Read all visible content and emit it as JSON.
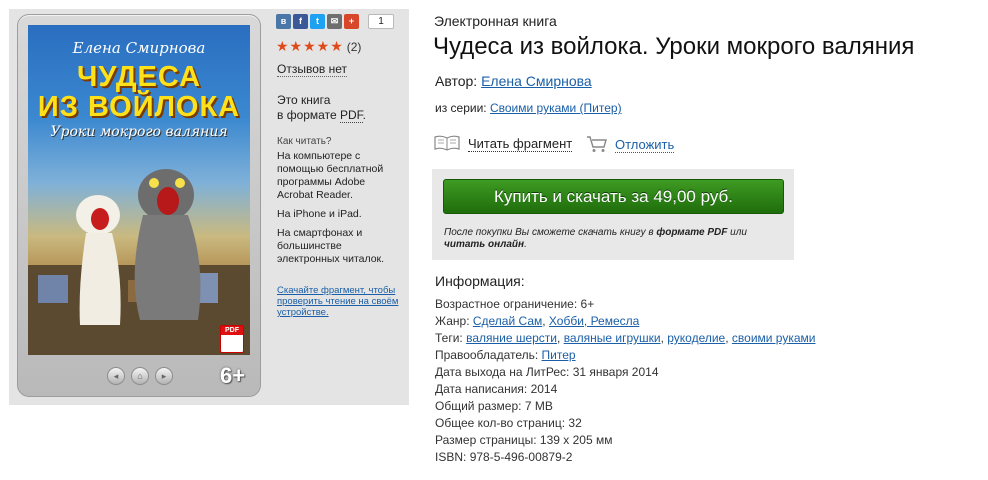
{
  "cover": {
    "author": "Елена Смирнова",
    "title_line1": "ЧУДЕСА",
    "title_line2": "ИЗ ВОЙЛОКА",
    "subtitle": "Уроки мокрого валяния",
    "pdf_badge": "PDF",
    "age_badge": "6+"
  },
  "social": {
    "counter": "1",
    "icons": [
      "vk-icon",
      "facebook-icon",
      "twitter-icon",
      "email-icon",
      "plus-icon"
    ]
  },
  "rating": {
    "stars": 5,
    "stars_text": "★★★★★",
    "count": "(2)"
  },
  "reviews_label": "Отзывов нет",
  "format": {
    "prefix": "Это книга",
    "line2": "в формате ",
    "format_name": "PDF",
    "suffix": "."
  },
  "howto": {
    "title": "Как читать?",
    "items": [
      "На компьютере с помощью бесплатной программы Adobe Acrobat Reader.",
      "На iPhone и iPad.",
      "На смартфонах и большинстве электронных читалок."
    ]
  },
  "download_fragment": "Скачайте фрагмент, чтобы проверить чтение на своём устройстве.",
  "book": {
    "type": "Электронная книга",
    "title": "Чудеса из войлока. Уроки мокрого валяния",
    "author_label": "Автор: ",
    "author": "Елена Смирнова",
    "series_label": "из серии: ",
    "series": "Своими руками (Питер)"
  },
  "actions": {
    "read_fragment": "Читать фрагмент",
    "postpone": "Отложить"
  },
  "buy": {
    "button": "Купить и скачать за 49,00 руб.",
    "note_part1": "После покупки Вы сможете скачать книгу в ",
    "note_bold1": "формате PDF",
    "note_part2": " или ",
    "note_bold2": "читать онлайн",
    "note_end": "."
  },
  "info": {
    "heading": "Информация:",
    "age_label": "Возрастное ограничение: ",
    "age": "6+",
    "genre_label": "Жанр: ",
    "genres": [
      "Сделай Сам",
      "Хобби, Ремесла"
    ],
    "tags_label": "Теги: ",
    "tags": [
      "валяние шерсти",
      "валяные игрушки",
      "рукоделие",
      "своими руками"
    ],
    "rights_label": "Правообладатель: ",
    "rights": "Питер",
    "release_label": "Дата выхода на ЛитРес: ",
    "release": "31 января 2014",
    "written_label": "Дата написания: ",
    "written": "2014",
    "size_label": "Общий размер: ",
    "size": "7 MB",
    "pages_label": "Общее кол-во страниц: ",
    "pages": "32",
    "page_size_label": "Размер страницы: ",
    "page_size": "139 x 205 мм",
    "isbn_label": "ISBN: ",
    "isbn": "978-5-496-00879-2"
  },
  "colors": {
    "link": "#1a5fa7",
    "buy_button": "#2e8417",
    "stars": "#e04a1a"
  }
}
